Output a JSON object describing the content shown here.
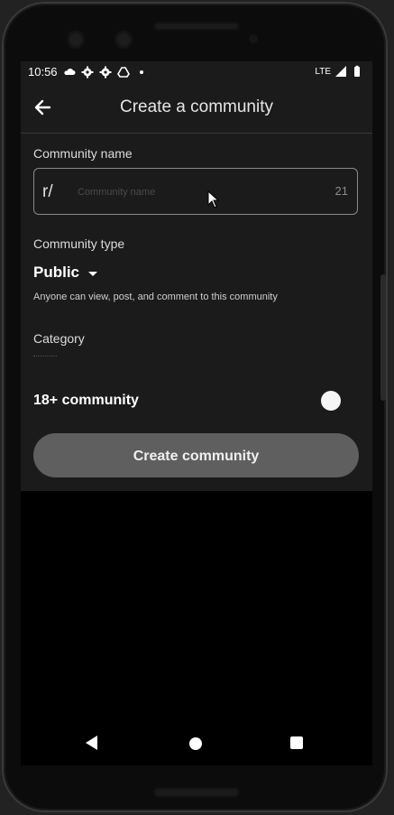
{
  "status_bar": {
    "time": "10:56",
    "network": "LTE",
    "icons": [
      "cloud-icon",
      "settings-icon",
      "settings-icon",
      "drive-icon",
      "dot-icon",
      "signal-icon",
      "battery-icon"
    ]
  },
  "app_bar": {
    "title": "Create a community",
    "back_icon": "arrow-left-icon"
  },
  "form": {
    "name_label": "Community name",
    "name_prefix": "r/",
    "name_placeholder": "Community name",
    "name_value": "",
    "char_count": "21",
    "type_label": "Community type",
    "type_value": "Public",
    "type_description": "Anyone can view, post, and comment to this community",
    "category_label": "Category",
    "nsfw_label": "18+ community",
    "nsfw_enabled": false,
    "submit_label": "Create community"
  },
  "colors": {
    "background": "#000000",
    "surface": "#1b1b1b",
    "button_disabled": "#5f5f5f",
    "text_primary": "#ffffff"
  }
}
